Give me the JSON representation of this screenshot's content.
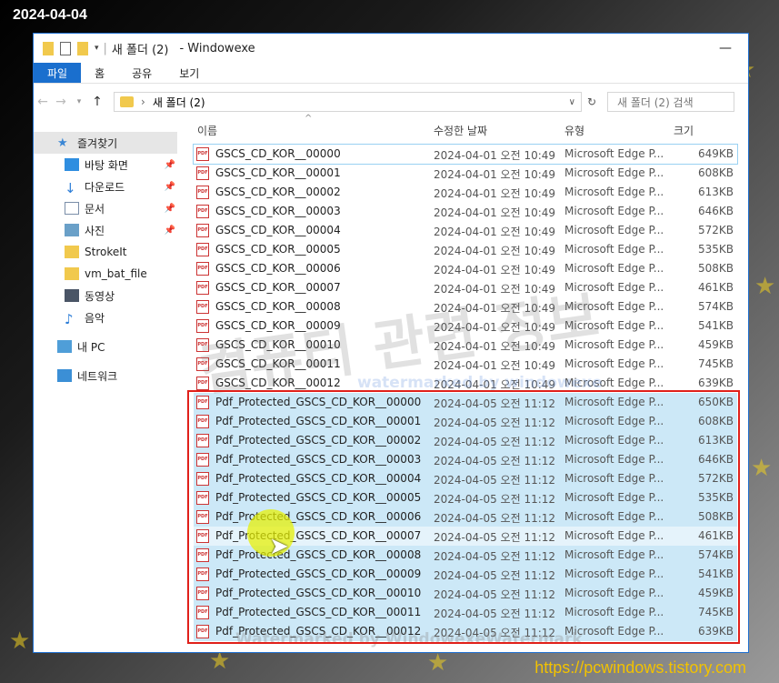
{
  "stamp": "2024-04-04",
  "site": "https://pcwindows.tistory.com",
  "watermarks": {
    "big": "컴퓨터 관련 정보",
    "mid": "watermarked by windowexe",
    "bottom": "Watermarked by WindowexeWatermark"
  },
  "window": {
    "title": "새 폴더 (2)",
    "app": "- Windowexe"
  },
  "ribbon": {
    "tabs": [
      "파일",
      "홈",
      "공유",
      "보기"
    ]
  },
  "address": {
    "path": "새 폴더 (2)",
    "search_placeholder": "새 폴더 (2) 검색"
  },
  "sidebar": {
    "items": [
      "즐겨찾기",
      "바탕 화면",
      "다운로드",
      "문서",
      "사진",
      "StrokeIt",
      "vm_bat_file",
      "동영상",
      "음악",
      "내 PC",
      "네트워크"
    ]
  },
  "columns": {
    "name": "이름",
    "date": "수정한 날짜",
    "type": "유형",
    "size": "크기"
  },
  "files": [
    {
      "name": "GSCS_CD_KOR__00000",
      "date": "2024-04-01 오전 10:49",
      "type": "Microsoft Edge P...",
      "size": "649KB"
    },
    {
      "name": "GSCS_CD_KOR__00001",
      "date": "2024-04-01 오전 10:49",
      "type": "Microsoft Edge P...",
      "size": "608KB"
    },
    {
      "name": "GSCS_CD_KOR__00002",
      "date": "2024-04-01 오전 10:49",
      "type": "Microsoft Edge P...",
      "size": "613KB"
    },
    {
      "name": "GSCS_CD_KOR__00003",
      "date": "2024-04-01 오전 10:49",
      "type": "Microsoft Edge P...",
      "size": "646KB"
    },
    {
      "name": "GSCS_CD_KOR__00004",
      "date": "2024-04-01 오전 10:49",
      "type": "Microsoft Edge P...",
      "size": "572KB"
    },
    {
      "name": "GSCS_CD_KOR__00005",
      "date": "2024-04-01 오전 10:49",
      "type": "Microsoft Edge P...",
      "size": "535KB"
    },
    {
      "name": "GSCS_CD_KOR__00006",
      "date": "2024-04-01 오전 10:49",
      "type": "Microsoft Edge P...",
      "size": "508KB"
    },
    {
      "name": "GSCS_CD_KOR__00007",
      "date": "2024-04-01 오전 10:49",
      "type": "Microsoft Edge P...",
      "size": "461KB"
    },
    {
      "name": "GSCS_CD_KOR__00008",
      "date": "2024-04-01 오전 10:49",
      "type": "Microsoft Edge P...",
      "size": "574KB"
    },
    {
      "name": "GSCS_CD_KOR__00009",
      "date": "2024-04-01 오전 10:49",
      "type": "Microsoft Edge P...",
      "size": "541KB"
    },
    {
      "name": "GSCS_CD_KOR__00010",
      "date": "2024-04-01 오전 10:49",
      "type": "Microsoft Edge P...",
      "size": "459KB"
    },
    {
      "name": "GSCS_CD_KOR__00011",
      "date": "2024-04-01 오전 10:49",
      "type": "Microsoft Edge P...",
      "size": "745KB"
    },
    {
      "name": "GSCS_CD_KOR__00012",
      "date": "2024-04-01 오전 10:49",
      "type": "Microsoft Edge P...",
      "size": "639KB"
    },
    {
      "name": "Pdf_Protected_GSCS_CD_KOR__00000",
      "date": "2024-04-05 오전 11:12",
      "type": "Microsoft Edge P...",
      "size": "650KB"
    },
    {
      "name": "Pdf_Protected_GSCS_CD_KOR__00001",
      "date": "2024-04-05 오전 11:12",
      "type": "Microsoft Edge P...",
      "size": "608KB"
    },
    {
      "name": "Pdf_Protected_GSCS_CD_KOR__00002",
      "date": "2024-04-05 오전 11:12",
      "type": "Microsoft Edge P...",
      "size": "613KB"
    },
    {
      "name": "Pdf_Protected_GSCS_CD_KOR__00003",
      "date": "2024-04-05 오전 11:12",
      "type": "Microsoft Edge P...",
      "size": "646KB"
    },
    {
      "name": "Pdf_Protected_GSCS_CD_KOR__00004",
      "date": "2024-04-05 오전 11:12",
      "type": "Microsoft Edge P...",
      "size": "572KB"
    },
    {
      "name": "Pdf_Protected_GSCS_CD_KOR__00005",
      "date": "2024-04-05 오전 11:12",
      "type": "Microsoft Edge P...",
      "size": "535KB"
    },
    {
      "name": "Pdf_Protected_GSCS_CD_KOR__00006",
      "date": "2024-04-05 오전 11:12",
      "type": "Microsoft Edge P...",
      "size": "508KB"
    },
    {
      "name": "Pdf_Protected_GSCS_CD_KOR__00007",
      "date": "2024-04-05 오전 11:12",
      "type": "Microsoft Edge P...",
      "size": "461KB"
    },
    {
      "name": "Pdf_Protected_GSCS_CD_KOR__00008",
      "date": "2024-04-05 오전 11:12",
      "type": "Microsoft Edge P...",
      "size": "574KB"
    },
    {
      "name": "Pdf_Protected_GSCS_CD_KOR__00009",
      "date": "2024-04-05 오전 11:12",
      "type": "Microsoft Edge P...",
      "size": "541KB"
    },
    {
      "name": "Pdf_Protected_GSCS_CD_KOR__00010",
      "date": "2024-04-05 오전 11:12",
      "type": "Microsoft Edge P...",
      "size": "459KB"
    },
    {
      "name": "Pdf_Protected_GSCS_CD_KOR__00011",
      "date": "2024-04-05 오전 11:12",
      "type": "Microsoft Edge P...",
      "size": "745KB"
    },
    {
      "name": "Pdf_Protected_GSCS_CD_KOR__00012",
      "date": "2024-04-05 오전 11:12",
      "type": "Microsoft Edge P...",
      "size": "639KB"
    }
  ],
  "file_icon": "pdf-file-icon",
  "icon_label": "PDF",
  "colors": {
    "accent": "#1a6fce",
    "selection": "#cce8f7",
    "highlight_box": "#e0201a"
  }
}
